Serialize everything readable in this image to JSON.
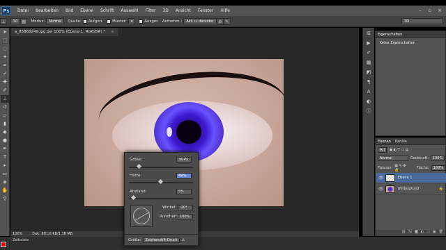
{
  "menubar": {
    "logo": "Ps",
    "items": [
      "Datei",
      "Bearbeiten",
      "Bild",
      "Ebene",
      "Schrift",
      "Auswahl",
      "Filter",
      "3D",
      "Ansicht",
      "Fenster",
      "Hilfe"
    ],
    "controls": [
      "–",
      "▫",
      "×"
    ]
  },
  "options": {
    "brush_size": "50",
    "mode_label": "Modus:",
    "mode_value": "Normal",
    "source_label": "Quelle:",
    "source_value": "Aufgen.",
    "pattern_label": "Muster:",
    "aligned_label": "Ausger.",
    "sample_label": "Aufnehm.:",
    "sample_value": "Akt. u. darunter",
    "workspace_value": "3D"
  },
  "document": {
    "tab_title": "a_85868249.jpg bei 100% (Ebene 1, RGB/8#) *",
    "zoom": "100%",
    "doc_info": "Dok: 801,6 KB/1,38 MB",
    "bottom_tab": "Zeitleiste"
  },
  "brush_popup": {
    "size_label": "Größe:",
    "size_value": "36 Px",
    "hardness_label": "Härte:",
    "hardness_value": "49%",
    "spacing_label": "Abstand:",
    "spacing_value": "5%",
    "angle_label": "Winkel:",
    "angle_value": "-20°",
    "roundness_label": "Rundheit:",
    "roundness_value": "100%",
    "size_mode_label": "Größe:",
    "size_mode_value": "Zeichenstift-Druck",
    "size_slider_fraction": 0.14,
    "hardness_slider_fraction": 0.49,
    "spacing_slider_fraction": 0.05
  },
  "properties_panel": {
    "tab": "Eigenschaften",
    "message": "Keine Eigenschaften"
  },
  "layers_panel": {
    "tabs": [
      "Ebenen",
      "Kanäle"
    ],
    "kind_filter": "Art",
    "blend_mode": "Normal",
    "opacity_label": "Deckkraft:",
    "opacity_value": "100%",
    "lock_label": "Fixieren:",
    "fill_label": "Fläche:",
    "fill_value": "100%",
    "layers": [
      {
        "name": "Ebene 1",
        "thumb": "checker",
        "active": true
      },
      {
        "name": "Hintergrund",
        "thumb": "eye",
        "active": false
      }
    ]
  },
  "colors": {
    "foreground": "#e00000",
    "background": "#ffffff",
    "iris_accent": "#4b2fc8",
    "selection": "#4b6a9c"
  }
}
